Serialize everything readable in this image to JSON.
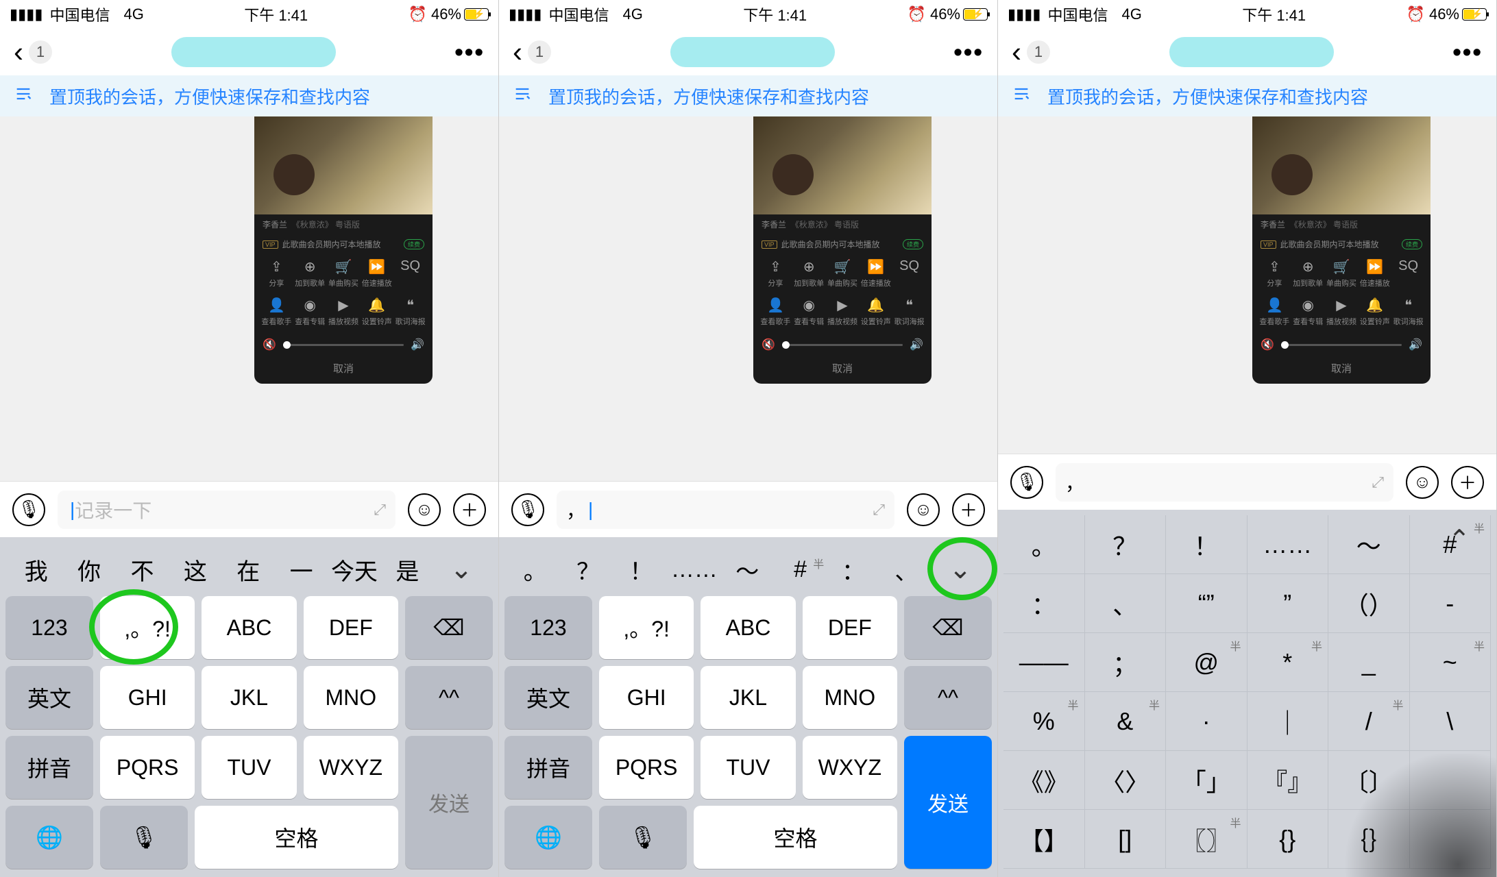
{
  "status": {
    "carrier": "中国电信",
    "network": "4G",
    "time": "下午 1:41",
    "alarm": "⏰",
    "battery_pct": "46%"
  },
  "nav": {
    "back_badge": "1",
    "more": "•••"
  },
  "pin_banner": "置顶我的会话，方便快速保存和查找内容",
  "msg_card": {
    "title_l": "李香兰",
    "title_r": "《秋意浓》 粤语版",
    "vip_text": "此歌曲会员期内可本地播放",
    "pill": "续费",
    "row1": [
      "分享",
      "加到歌单",
      "单曲购买",
      "倍速播放",
      ""
    ],
    "row2": [
      "查看歌手",
      "查看专辑",
      "播放视频",
      "设置铃声",
      "歌词海报"
    ],
    "cancel": "取消"
  },
  "inputs": {
    "placeholder": "记录一下",
    "value2": "，",
    "value3": "，"
  },
  "kbd9": {
    "cand1": [
      "我",
      "你",
      "不",
      "这",
      "在",
      "一",
      "今天",
      "是"
    ],
    "cand2": [
      "。",
      "？",
      "！",
      "……",
      "～",
      "#",
      "：",
      "、"
    ],
    "cand2_sup": {
      "5": "半"
    },
    "k_123": "123",
    "k_sym": ",。?!",
    "k_abc": "ABC",
    "k_def": "DEF",
    "k_en": "英文",
    "k_ghi": "GHI",
    "k_jkl": "JKL",
    "k_mno": "MNO",
    "k_face": "^^",
    "k_py": "拼音",
    "k_pqrs": "PQRS",
    "k_tuv": "TUV",
    "k_wxyz": "WXYZ",
    "k_send": "发送",
    "k_space": "空格",
    "k_globe": "🌐",
    "k_mic": "🎙",
    "k_del": "⌫"
  },
  "sym_grid": [
    [
      "。",
      "？",
      "！",
      "……",
      "～",
      "#"
    ],
    [
      "：",
      "、",
      "“”",
      "”",
      "（）",
      "-"
    ],
    [
      "——",
      "；",
      "@",
      "*",
      "_",
      "~"
    ],
    [
      "%",
      "&",
      "·",
      "｜",
      "/",
      "\\"
    ],
    [
      "《》",
      "〈〉",
      "「」",
      "『』",
      "〔〕",
      ""
    ],
    [
      "【】",
      "[]",
      "〖〗",
      "{}",
      "｛｝",
      ""
    ]
  ],
  "sym_sup": {
    "0-5": "半",
    "2-2": "半",
    "2-3": "半",
    "2-5": "半",
    "3-0": "半",
    "3-1": "半",
    "3-4": "半",
    "3-5": "",
    "5-2": "半"
  },
  "chevron_down": "⌄",
  "chevron_up": "⌃"
}
